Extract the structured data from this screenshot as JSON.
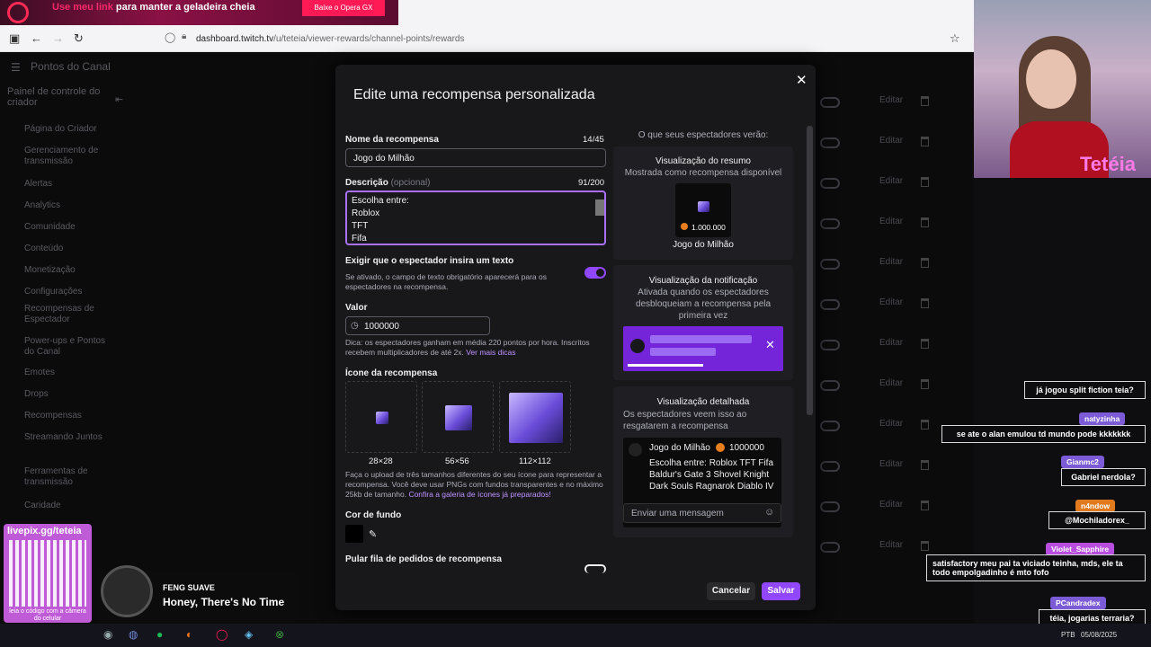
{
  "browser": {
    "ad_text_pre": "Use meu link",
    "ad_text_post": " para manter a geladeira cheia",
    "ad_button": "Baixe o Opera GX",
    "url_domain": "dashboard.twitch.tv",
    "url_path": "/u/teteia/viewer-rewards/channel-points/rewards"
  },
  "background": {
    "header_title": "Pontos do Canal",
    "panel_title": "Painel de controle do criador",
    "sidebar": [
      "Página do Criador",
      "Gerenciamento de transmissão",
      "Alertas",
      "Analytics",
      "Comunidade",
      "Conteúdo",
      "Monetização",
      "Configurações",
      "Recompensas de Espectador",
      "Power-ups e Pontos do Canal",
      "Emotes",
      "Drops",
      "Recompensas",
      "Streamando Juntos",
      "Ferramentas de transmissão",
      "Caridade"
    ],
    "edit_label": "Editar"
  },
  "modal": {
    "title": "Edite uma recompensa personalizada",
    "name_label": "Nome da recompensa",
    "name_count": "14/45",
    "name_value": "Jogo do Milhão",
    "desc_label": "Descrição",
    "desc_optional": "(opcional)",
    "desc_count": "91/200",
    "desc_lines": [
      "Escolha entre:",
      "Roblox",
      "TFT",
      "Fifa"
    ],
    "require_text_label": "Exigir que o espectador insira um texto",
    "require_text_help": "Se ativado, o campo de texto obrigatório aparecerá para os espectadores na recompensa.",
    "value_label": "Valor",
    "value": "1000000",
    "value_help": "Dica: os espectadores ganham em média 220 pontos por hora. Inscritos recebem multiplicadores de até 2x.",
    "value_help_link": "Ver mais dicas",
    "icon_label": "Ícone da recompensa",
    "icon_sizes": [
      "28×28",
      "56×56",
      "112×112"
    ],
    "icon_help": "Faça o upload de três tamanhos diferentes do seu ícone para representar a recompensa. Você deve usar PNGs com fundos transparentes e no máximo 25kb de tamanho.",
    "icon_help_link": "Confira a galeria de ícones já preparados!",
    "bg_color_label": "Cor de fundo",
    "skip_queue_label": "Pular fila de pedidos de recompensa",
    "cancel": "Cancelar",
    "save": "Salvar"
  },
  "preview": {
    "header": "O que seus espectadores verão:",
    "summary_title": "Visualização do resumo",
    "summary_sub": "Mostrada como recompensa disponível",
    "summary_cost": "1.000.000",
    "summary_name": "Jogo do Milhão",
    "notif_title": "Visualização da notificação",
    "notif_sub": "Ativada quando os espectadores desbloqueiam a recompensa pela primeira vez",
    "detail_title": "Visualização detalhada",
    "detail_sub": "Os espectadores veem isso ao resgatarem a recompensa",
    "detail_name": "Jogo do Milhão",
    "detail_cost": "1000000",
    "detail_desc": "Escolha entre: Roblox TFT Fifa Baldur's Gate 3 Shovel Knight Dark Souls Ragnarok Diablo IV",
    "message_placeholder": "Enviar uma mensagem"
  },
  "stream": {
    "cam_name": "Tetéia",
    "chat": [
      {
        "name": "",
        "msg": "já jogou split fiction teia?"
      },
      {
        "name": "natyzinha",
        "msg": "se ate o alan emulou td mundo pode kkkkkkk"
      },
      {
        "name": "Gianmc2",
        "msg": "Gabriel nerdola?"
      },
      {
        "name": "n4ndow",
        "msg": "@Mochiladorex_"
      },
      {
        "name": "Violet_Sapphire",
        "msg": "satisfactory meu pai ta viciado teinha, mds, ele ta todo empolgadinho é mto fofo"
      },
      {
        "name": "PCandradex",
        "msg": "téia, jogarias terraria?"
      }
    ],
    "qr_title": "livepix.gg/teteia",
    "qr_caption": "leia o código com a câmera do celular",
    "music_artist": "FENG SUAVE",
    "music_title": "Honey, There's No Time",
    "taskbar_lang": "PTB",
    "taskbar_date": "05/08/2025"
  },
  "colors": {
    "accent": "#9147ff",
    "accent_light": "#a970ff",
    "modal_bg": "#18181b",
    "chat_name": "#7c5bd6"
  }
}
